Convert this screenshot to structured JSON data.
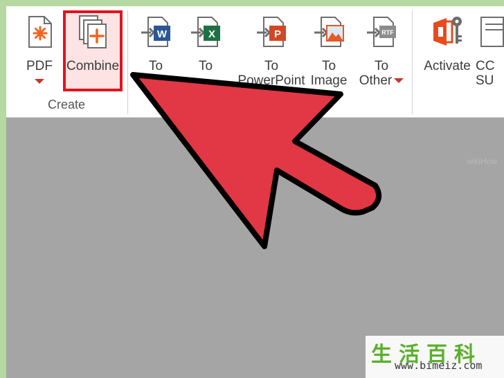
{
  "ribbon": {
    "buttons": {
      "pdf": {
        "label": "PDF"
      },
      "combine": {
        "label": "Combine"
      },
      "to_word": {
        "line1": "To",
        "line2": ""
      },
      "to_excel": {
        "line1": "To",
        "line2": ""
      },
      "to_powerpoint": {
        "line1": "To",
        "line2": "PowerPoint"
      },
      "to_image": {
        "line1": "To",
        "line2": "Image"
      },
      "to_other": {
        "line1": "To",
        "line2": "Other"
      },
      "activate": {
        "label": "Activate"
      },
      "cc_support": {
        "line1": "CC",
        "line2": "SU"
      }
    },
    "group_create": "Create",
    "icon_letters": {
      "word": "W",
      "excel": "X",
      "powerpoint": "P",
      "rtf": "RTF"
    }
  },
  "colors": {
    "highlight_border": "#e0141e",
    "arrow_fill": "#e23744",
    "caret": "#c0392b",
    "frame": "#b5d9a1"
  },
  "icons": {
    "pdf": "pdf-create-icon",
    "combine": "combine-files-icon",
    "word": "to-word-icon",
    "excel": "to-excel-icon",
    "powerpoint": "to-powerpoint-icon",
    "image": "to-image-icon",
    "rtf": "to-rtf-icon",
    "activate": "office-key-icon"
  },
  "watermark": {
    "cn": "生活百科",
    "url": "www.bimeiz.com",
    "how": "wikiHow"
  }
}
